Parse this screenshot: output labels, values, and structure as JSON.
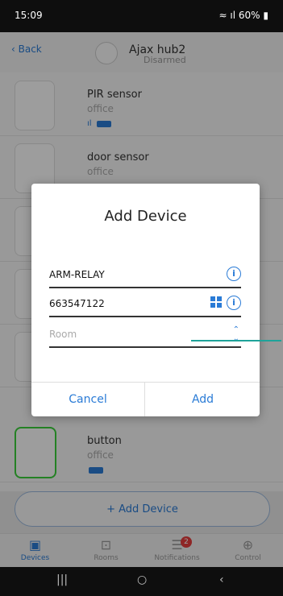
{
  "status": {
    "time": "15:09",
    "battery": "60%"
  },
  "header": {
    "back": "Back",
    "title": "Ajax hub2",
    "subtitle": "Disarmed"
  },
  "devices": [
    {
      "name": "PIR sensor",
      "room": "office"
    },
    {
      "name": "door sensor",
      "room": "office"
    },
    {
      "name": "button",
      "room": "office"
    }
  ],
  "add_device_button": "+ Add Device",
  "tabs": [
    {
      "label": "Devices",
      "icon": "devices-icon"
    },
    {
      "label": "Rooms",
      "icon": "rooms-icon"
    },
    {
      "label": "Notifications",
      "icon": "notifications-icon",
      "badge": "2"
    },
    {
      "label": "Control",
      "icon": "control-icon"
    }
  ],
  "dialog": {
    "title": "Add Device",
    "name_value": "ARM-RELAY",
    "id_value": "663547122",
    "room_placeholder": "Room",
    "cancel": "Cancel",
    "add": "Add"
  },
  "colors": {
    "accent": "#2a7bd6",
    "annotation": "#1ea39a",
    "badge": "#e53c3c"
  }
}
